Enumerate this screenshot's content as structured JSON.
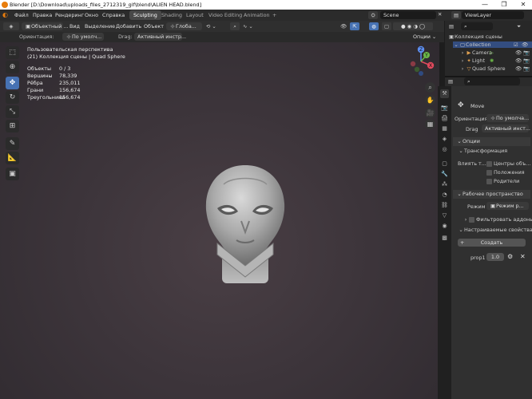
{
  "window": {
    "title": "Blender [D:\\Download\\uploads_files_2712319_gif\\blend\\ALIEN HEAD.blend]",
    "min": "—",
    "max": "❐",
    "close": "✕"
  },
  "menu": [
    "Файл",
    "Правка",
    "Рендеринг",
    "Окно",
    "Справка"
  ],
  "workspaces": {
    "active": "Sculpting",
    "others": [
      "Shading",
      "Layout",
      "Video Editing",
      "Animation"
    ],
    "add": "+"
  },
  "scene": {
    "name": "Scene",
    "view_layer": "ViewLayer"
  },
  "header3d": {
    "mode": "Объектный ...",
    "items": [
      "Вид",
      "Выделение",
      "Добавить",
      "Объект"
    ],
    "transform": "Глоба..."
  },
  "tool_settings": {
    "orientation_label": "Ориентация:",
    "orientation_value": "По умолч...",
    "drag_label": "Drag:",
    "drag_value": "Активный инстр...",
    "options": "Опции"
  },
  "viewport": {
    "view_name": "Пользовательская перспектива",
    "collection_info": "(21) Коллекция сцены | Quad Sphere"
  },
  "stats": [
    {
      "k": "Объекты",
      "v": "0 / 3"
    },
    {
      "k": "Вершины",
      "v": "78,339"
    },
    {
      "k": "Рёбра",
      "v": "235,011"
    },
    {
      "k": "Грани",
      "v": "156,674"
    },
    {
      "k": "Треугольники",
      "v": "156,674"
    }
  ],
  "gizmo": {
    "z": "Z",
    "y": "Y",
    "x": "X"
  },
  "outliner": {
    "root": "Коллекция сцены",
    "collection": "Collection",
    "items": [
      "Camera",
      "Light",
      "Quad Sphere"
    ]
  },
  "properties": {
    "tool_name": "Move",
    "orientation_label": "Ориентация",
    "orientation_value": "По умолча...",
    "drag_label": "Drag",
    "drag_value": "Активный инст...",
    "options_section": "Опции",
    "transform_section": "Трансформация",
    "affect_label": "Влиять т...",
    "affect_options": [
      "Центры объ...",
      "Положения",
      "Родители"
    ],
    "workspace_section": "Рабочее пространство",
    "mode_label": "Режим",
    "mode_value": "Режим р...",
    "filter_addons": "Фильтровать аддоны",
    "custom_props": "Настраиваемые свойства",
    "create_button": "Создать",
    "prop_name": "prop1",
    "prop_value": "1.0"
  },
  "colors": {
    "accent": "#4772b3",
    "background": "#3d353b"
  }
}
